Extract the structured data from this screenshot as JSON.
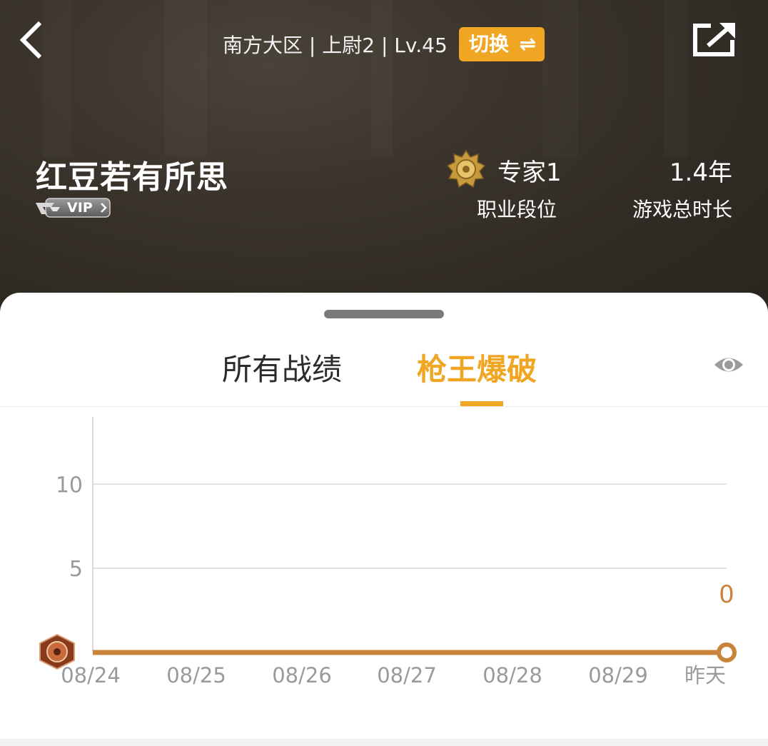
{
  "header": {
    "server_info": "南方大区 | 上尉2 | Lv.45",
    "switch_label": "切换",
    "switch_arrows": "⇌"
  },
  "player": {
    "name": "红豆若有所思",
    "vip_label": "VIP"
  },
  "stats": {
    "rank_name": "专家1",
    "rank_label": "职业段位",
    "playtime_value": "1.4年",
    "playtime_label": "游戏总时长"
  },
  "tabs": [
    {
      "label": "所有战绩",
      "active": false
    },
    {
      "label": "枪王爆破",
      "active": true
    }
  ],
  "colors": {
    "accent": "#f1a623",
    "line": "#c8843a",
    "header_dark": "#2f2a23"
  },
  "icons": {
    "back": "chevron-left-icon",
    "share": "share-icon",
    "eye": "eye-icon",
    "rank": "rank-emblem-icon",
    "series_marker": "rank-medal-icon"
  },
  "chart_data": {
    "type": "line",
    "categories": [
      "08/24",
      "08/25",
      "08/26",
      "08/27",
      "08/28",
      "08/29",
      "昨天"
    ],
    "series": [
      {
        "values": [
          0,
          0,
          0,
          0,
          0,
          0,
          0
        ]
      }
    ],
    "y_ticks": [
      5,
      10
    ],
    "ylim": [
      0,
      14
    ],
    "last_value_label": "0",
    "grid": true
  }
}
